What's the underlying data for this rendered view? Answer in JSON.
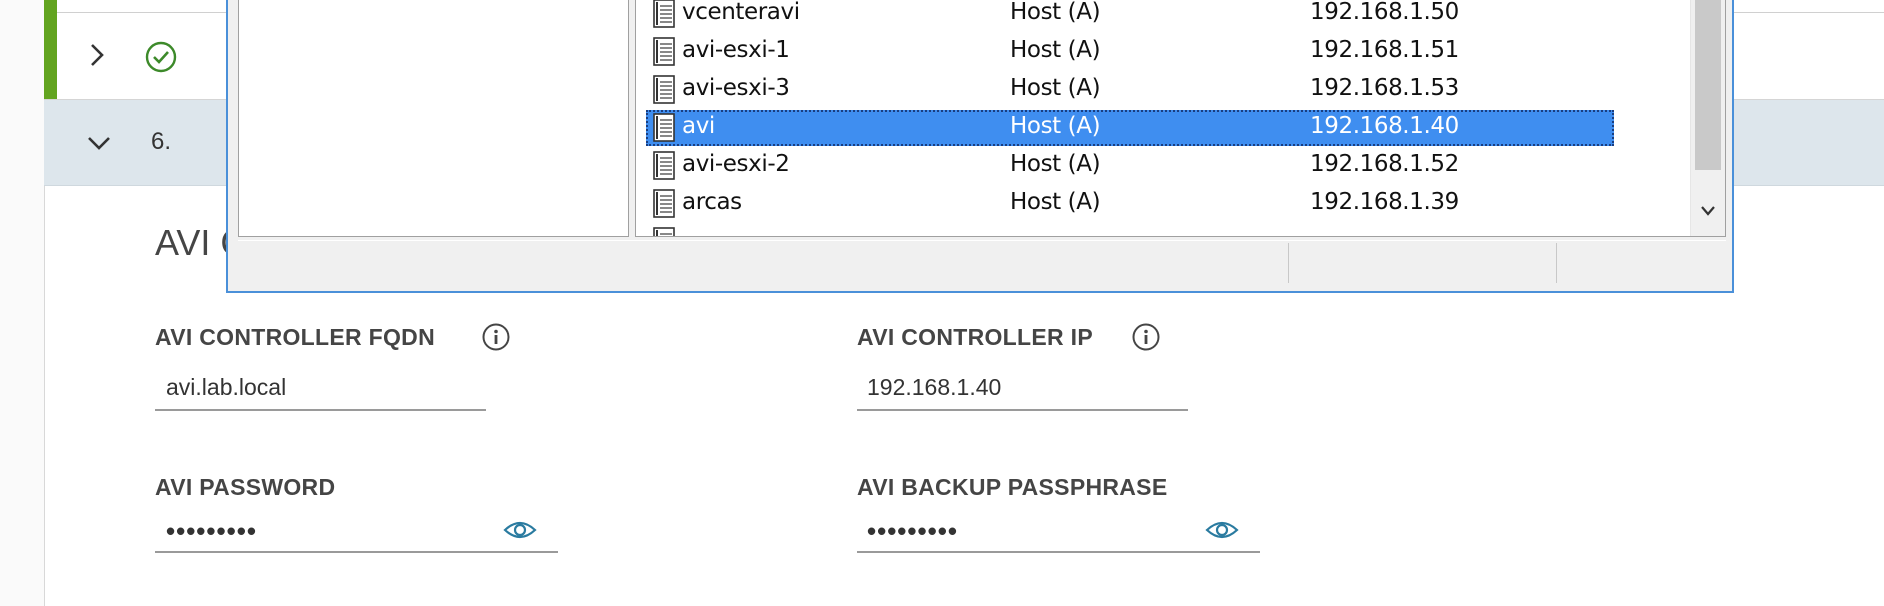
{
  "wizard": {
    "step5": {
      "status_color": "#62a420"
    },
    "step6": {
      "number": "6."
    },
    "section_title": "AVI C"
  },
  "form": {
    "controller_fqdn": {
      "label": "AVI CONTROLLER FQDN",
      "value": "avi.lab.local"
    },
    "controller_ip": {
      "label": "AVI CONTROLLER IP",
      "value": "192.168.1.40"
    },
    "password": {
      "label": "AVI PASSWORD",
      "value": "•••••••••"
    },
    "backup_passphrase": {
      "label": "AVI BACKUP PASSPHRASE",
      "value": "•••••••••"
    }
  },
  "dns_window": {
    "records": [
      {
        "name": "vcenteravi",
        "type": "Host (A)",
        "data": "192.168.1.50",
        "selected": false
      },
      {
        "name": "avi-esxi-1",
        "type": "Host (A)",
        "data": "192.168.1.51",
        "selected": false
      },
      {
        "name": "avi-esxi-3",
        "type": "Host (A)",
        "data": "192.168.1.53",
        "selected": false
      },
      {
        "name": "avi",
        "type": "Host (A)",
        "data": "192.168.1.40",
        "selected": true
      },
      {
        "name": "avi-esxi-2",
        "type": "Host (A)",
        "data": "192.168.1.52",
        "selected": false
      },
      {
        "name": "arcas",
        "type": "Host (A)",
        "data": "192.168.1.39",
        "selected": false
      }
    ],
    "selection_color": "#3f8ef0"
  },
  "icons": {
    "step5_expand": "chevron-right-icon",
    "step5_status": "check-circle-icon",
    "step6_collapse": "chevron-down-icon",
    "field_info": "info-icon",
    "password_reveal": "eye-icon",
    "record": "host-record-icon",
    "scroll_down": "chevron-down-icon"
  }
}
